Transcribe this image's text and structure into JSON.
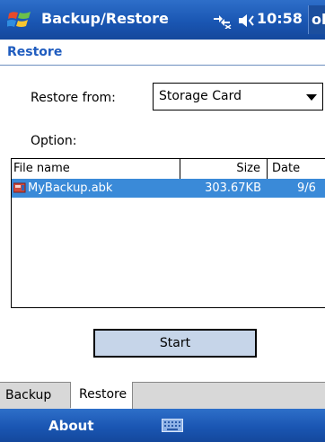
{
  "titlebar": {
    "app_title": "Backup/Restore",
    "time": "10:58",
    "ok_label": "ok",
    "icons": [
      "start-logo-icon",
      "connectivity-icon",
      "volume-icon"
    ]
  },
  "header": {
    "title": "Restore"
  },
  "form": {
    "restore_from_label": "Restore from:",
    "restore_from_value": "Storage Card",
    "option_label": "Option:"
  },
  "filelist": {
    "columns": [
      "File name",
      "Size",
      "Date"
    ],
    "rows": [
      {
        "name": "MyBackup.abk",
        "size": "303.67KB",
        "date": "9/6",
        "selected": true
      }
    ]
  },
  "start_button": {
    "label": "Start"
  },
  "tabs": [
    {
      "label": "Backup",
      "active": false
    },
    {
      "label": "Restore",
      "active": true
    }
  ],
  "softbar": {
    "left_label": "About",
    "input_icon": "keyboard-icon"
  },
  "colors": {
    "titlebar": "#1a56b3",
    "header_text": "#1f5cbf",
    "selection": "#3a8ad8",
    "button_bg": "#c6d5e9"
  }
}
